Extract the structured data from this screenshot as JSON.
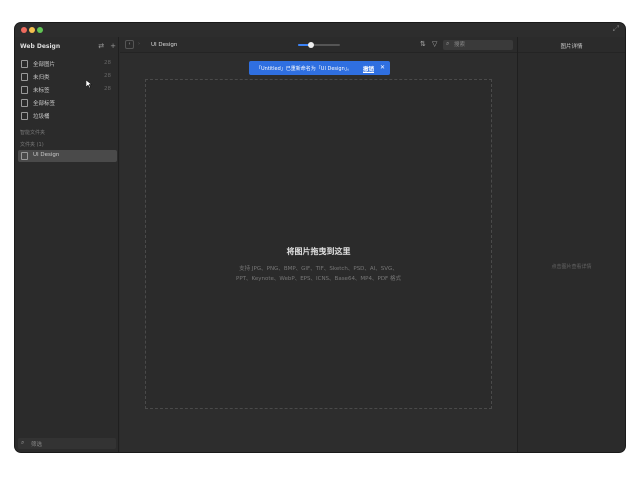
{
  "sidebar": {
    "title": "Web Design",
    "items": [
      {
        "label": "全部图片",
        "count": "28"
      },
      {
        "label": "未归类",
        "count": "28"
      },
      {
        "label": "未标签",
        "count": "28"
      },
      {
        "label": "全部标签",
        "count": ""
      },
      {
        "label": "垃圾桶",
        "count": ""
      }
    ],
    "smart_folders_label": "智能文件夹",
    "folders_label": "文件夹 (1)",
    "folders": [
      {
        "label": "UI Design"
      }
    ],
    "filter_placeholder": "筛选"
  },
  "toolbar": {
    "breadcrumb": "UI Design",
    "zoom_level": 0.3,
    "search_placeholder": "搜索"
  },
  "toast": {
    "message": "「Untitled」已重新命名为「UI Design」。",
    "undo_label": "撤销"
  },
  "drop_zone": {
    "title": "将图片拖曳到这里",
    "formats_line1": "支持 JPG、PNG、BMP、GIF、TIF、Sketch、PSD、AI、SVG、",
    "formats_line2": "PPT、Keynote、WebP、EPS、ICNS、Base64、MP4、PDF 格式"
  },
  "right_panel": {
    "title": "图片详情",
    "empty_text": "点击图片查看详情"
  },
  "colors": {
    "accent": "#3b82f6",
    "toast_bg": "#2f6fe0"
  }
}
